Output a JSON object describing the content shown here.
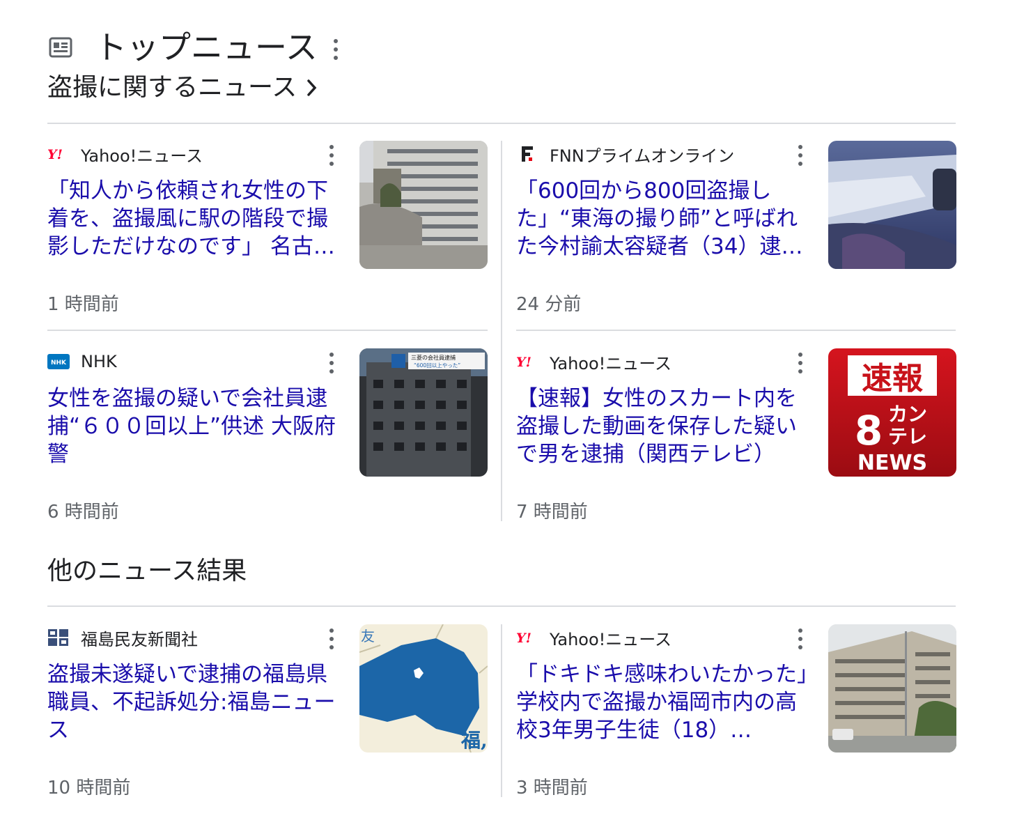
{
  "header": {
    "title": "トップニュース",
    "subtitle": "盗撮に関するニュース"
  },
  "top_news": [
    {
      "source": "Yahoo!ニュース",
      "logo": "yahoo-logo",
      "headline": "「知人から依頼され女性の下着を、盗撮風に駅の階段で撮影しただけなのです」 名古…",
      "time": "1 時間前",
      "thumb": "building-photo"
    },
    {
      "source": "FNNプライムオンライン",
      "logo": "fnn-logo",
      "headline": "「600回から800回盗撮した」“東海の撮り師”と呼ばれた今村諭太容疑者（34）逮…",
      "time": "24 分前",
      "thumb": "car-window-photo"
    },
    {
      "source": "NHK",
      "logo": "nhk-logo",
      "headline": "女性を盗撮の疑いで会社員逮捕“６００回以上”供述 大阪府警",
      "time": "6 時間前",
      "thumb": "office-building-photo",
      "thumb_caption": "三菱の会社員逮捕",
      "thumb_caption2": "“600回以上やった”"
    },
    {
      "source": "Yahoo!ニュース",
      "logo": "yahoo-logo",
      "headline": "【速報】女性のスカート内を盗撮した動画を保存した疑いで男を逮捕（関西テレビ）",
      "time": "7 時間前",
      "thumb": "breaking-news-graphic",
      "thumb_line1": "速報",
      "thumb_line2": "8",
      "thumb_line3": "カン",
      "thumb_line4": "テレ",
      "thumb_line5": "NEWS"
    }
  ],
  "other": {
    "title": "他のニュース結果",
    "items": [
      {
        "source": "福島民友新聞社",
        "logo": "minyu-logo",
        "headline": "盗撮未遂疑いで逮捕の福島県職員、不起訴処分:福島ニュース",
        "time": "10 時間前",
        "thumb": "fukushima-map",
        "map_label1": "友",
        "map_label2": "福,"
      },
      {
        "source": "Yahoo!ニュース",
        "logo": "yahoo-logo",
        "headline": "「ドキドキ感味わいたかった」学校内で盗撮か福岡市内の高校3年男子生徒（18）…",
        "time": "3 時間前",
        "thumb": "police-building-photo"
      }
    ]
  },
  "colors": {
    "link": "#1a0dab",
    "meta": "#5f6368",
    "divider": "#dadce0",
    "yahoo_red": "#ff0033",
    "nhk_blue": "#0076c0",
    "breaking_red": "#c8121a"
  }
}
